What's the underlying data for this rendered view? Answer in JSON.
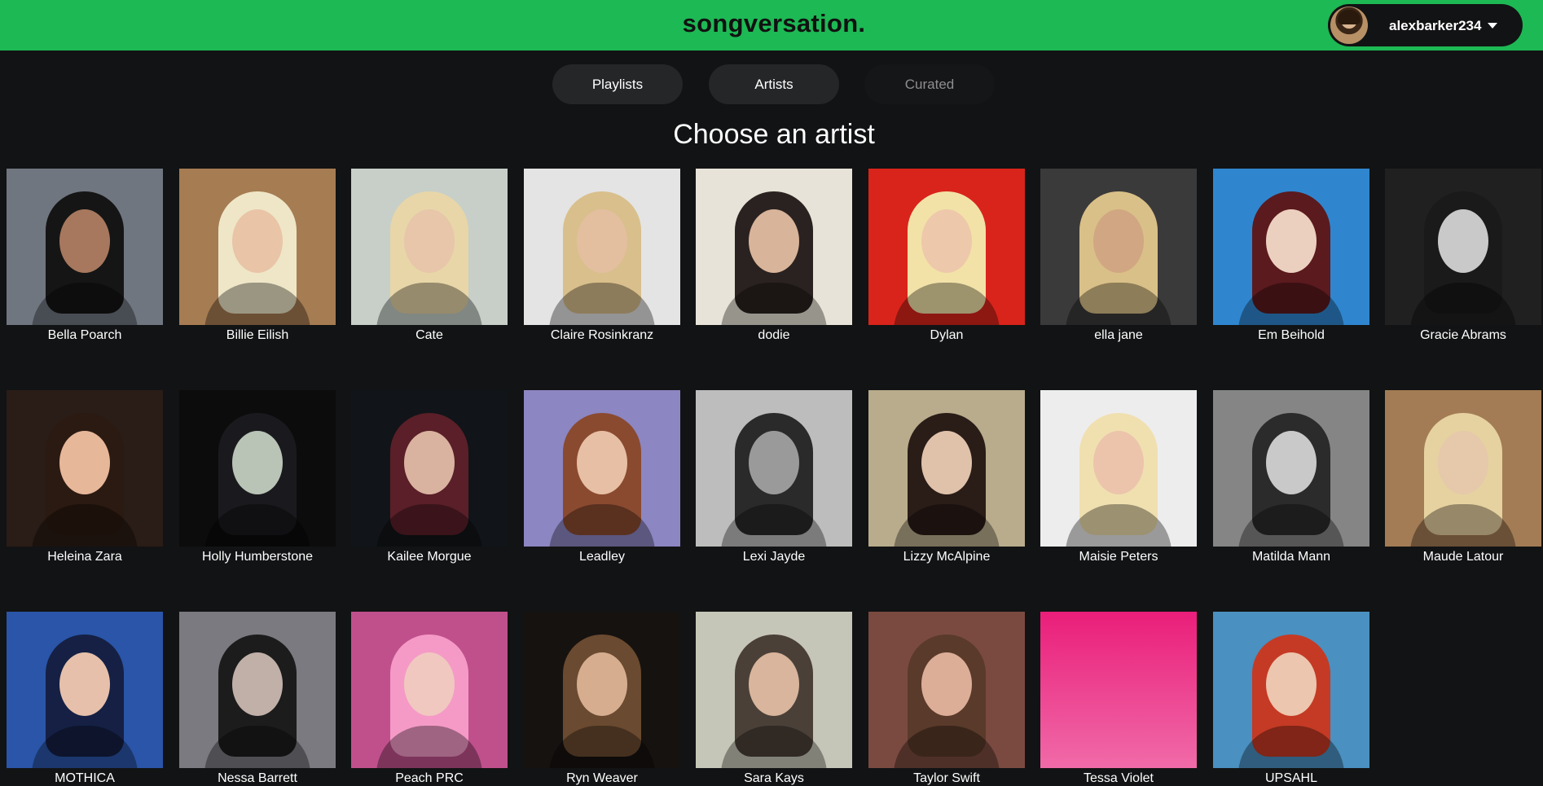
{
  "app": {
    "brand": "songversation.",
    "username": "alexbarker234"
  },
  "tabs": [
    {
      "label": "Playlists",
      "active": false
    },
    {
      "label": "Artists",
      "active": true
    },
    {
      "label": "Curated",
      "active": false
    }
  ],
  "heading": "Choose an artist",
  "artists": [
    {
      "name": "Bella Poarch",
      "bg": "#6f7680",
      "hair": "#151515",
      "skin": "#a7785e"
    },
    {
      "name": "Billie Eilish",
      "bg": "#a67c52",
      "hair": "#efe6c8",
      "skin": "#e9c4a6"
    },
    {
      "name": "Cate",
      "bg": "#c7cfc8",
      "hair": "#e8d6a8",
      "skin": "#e7c6aa"
    },
    {
      "name": "Claire Rosinkranz",
      "bg": "#e4e4e4",
      "hair": "#d9bf8c",
      "skin": "#e3bf9f"
    },
    {
      "name": "dodie",
      "bg": "#e8e3d8",
      "hair": "#2a2220",
      "skin": "#d8b49a"
    },
    {
      "name": "Dylan",
      "bg": "#d9241b",
      "hair": "#f2e2a8",
      "skin": "#eec8aa"
    },
    {
      "name": "ella jane",
      "bg": "#3b3a3a",
      "hair": "#d9c088",
      "skin": "#d1a682"
    },
    {
      "name": "Em Beihold",
      "bg": "#2f86cf",
      "hair": "#5b1a1e",
      "skin": "#ecd0bf"
    },
    {
      "name": "Gracie Abrams",
      "bg": "#202020",
      "hair": "#1a1a1a",
      "skin": "#c9c9c9"
    },
    {
      "name": "Heleina Zara",
      "bg": "#2a1c16",
      "hair": "#2b1a12",
      "skin": "#e7b79a"
    },
    {
      "name": "Holly Humberstone",
      "bg": "#0c0c0c",
      "hair": "#1a1a1e",
      "skin": "#b9c4b7"
    },
    {
      "name": "Kailee Morgue",
      "bg": "#111418",
      "hair": "#5a1f28",
      "skin": "#d9b3a0"
    },
    {
      "name": "Leadley",
      "bg": "#8c86c2",
      "hair": "#8a4a30",
      "skin": "#e7bfa4"
    },
    {
      "name": "Lexi Jayde",
      "bg": "#bdbdbd",
      "hair": "#2a2a2a",
      "skin": "#9a9a9a"
    },
    {
      "name": "Lizzy McAlpine",
      "bg": "#b9ac8c",
      "hair": "#2a1d18",
      "skin": "#e0c2ab"
    },
    {
      "name": "Maisie Peters",
      "bg": "#ededed",
      "hair": "#f0e0b0",
      "skin": "#ecc4ab"
    },
    {
      "name": "Matilda Mann",
      "bg": "#858585",
      "hair": "#2b2b2b",
      "skin": "#c9c9c9"
    },
    {
      "name": "Maude Latour",
      "bg": "#a37c55",
      "hair": "#e6d2a0",
      "skin": "#e6c8ab"
    },
    {
      "name": "MOTHICA",
      "bg": "#2a55a8",
      "hair": "#152044",
      "skin": "#e6c0aa"
    },
    {
      "name": "Nessa Barrett",
      "bg": "#7a7a80",
      "hair": "#1c1c1c",
      "skin": "#c0b0a8"
    },
    {
      "name": "Peach PRC",
      "bg": "#c0508c",
      "hair": "#f59ac6",
      "skin": "#f0c8c0"
    },
    {
      "name": "Ryn Weaver",
      "bg": "#161210",
      "hair": "#6a4a30",
      "skin": "#d6ad8f"
    },
    {
      "name": "Sara Kays",
      "bg": "#c6c6b8",
      "hair": "#4a4038",
      "skin": "#d8b59c"
    },
    {
      "name": "Taylor Swift",
      "bg": "#7a4a40",
      "hair": "#5a3a2a",
      "skin": "#dcae98"
    },
    {
      "name": "Tessa Violet",
      "bg": "#ea1e7a",
      "hair": "",
      "skin": ""
    },
    {
      "name": "UPSAHL",
      "bg": "#4a90c0",
      "hair": "#c53a24",
      "skin": "#ecc6ae"
    }
  ]
}
